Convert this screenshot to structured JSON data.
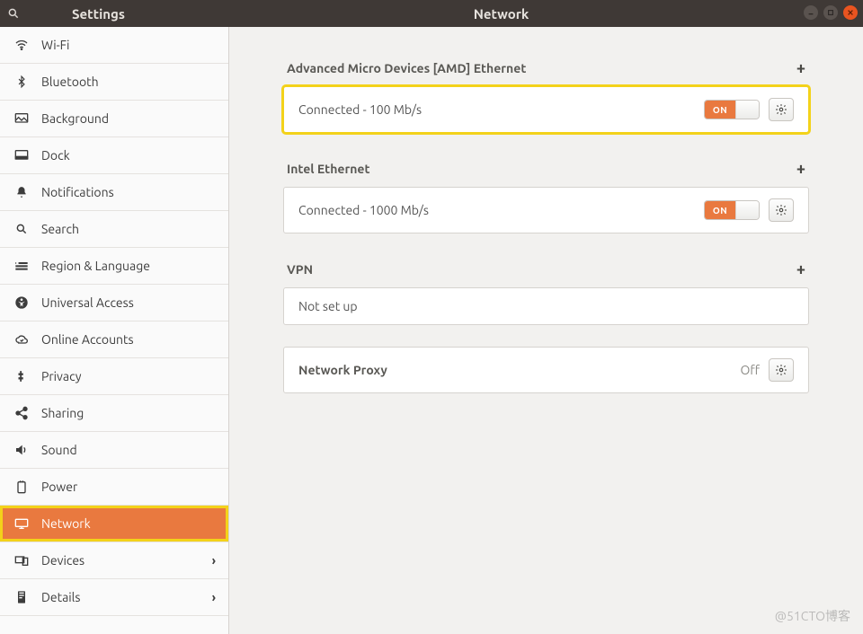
{
  "titlebar": {
    "app_title": "Settings",
    "page_title": "Network"
  },
  "sidebar": {
    "items": [
      {
        "icon": "wifi",
        "label": "Wi-Fi",
        "chevron": false
      },
      {
        "icon": "bluetooth",
        "label": "Bluetooth",
        "chevron": false
      },
      {
        "icon": "background",
        "label": "Background",
        "chevron": false
      },
      {
        "icon": "dock",
        "label": "Dock",
        "chevron": false
      },
      {
        "icon": "bell",
        "label": "Notifications",
        "chevron": false
      },
      {
        "icon": "search",
        "label": "Search",
        "chevron": false
      },
      {
        "icon": "region",
        "label": "Region & Language",
        "chevron": false
      },
      {
        "icon": "access",
        "label": "Universal Access",
        "chevron": false
      },
      {
        "icon": "cloud",
        "label": "Online Accounts",
        "chevron": false
      },
      {
        "icon": "privacy",
        "label": "Privacy",
        "chevron": false
      },
      {
        "icon": "share",
        "label": "Sharing",
        "chevron": false
      },
      {
        "icon": "sound",
        "label": "Sound",
        "chevron": false
      },
      {
        "icon": "power",
        "label": "Power",
        "chevron": false
      },
      {
        "icon": "network",
        "label": "Network",
        "chevron": false,
        "active": true,
        "highlight": true
      },
      {
        "icon": "devices",
        "label": "Devices",
        "chevron": true
      },
      {
        "icon": "details",
        "label": "Details",
        "chevron": true
      }
    ]
  },
  "network": {
    "sections": [
      {
        "title": "Advanced Micro Devices [AMD] Ethernet",
        "add": "+",
        "status": "Connected - 100 Mb/s",
        "toggle": "ON",
        "highlight": true
      },
      {
        "title": "Intel Ethernet",
        "add": "+",
        "status": "Connected - 1000 Mb/s",
        "toggle": "ON",
        "highlight": false
      }
    ],
    "vpn": {
      "title": "VPN",
      "add": "+",
      "status": "Not set up"
    },
    "proxy": {
      "label": "Network Proxy",
      "state": "Off"
    }
  },
  "watermark": "@51CTO博客"
}
